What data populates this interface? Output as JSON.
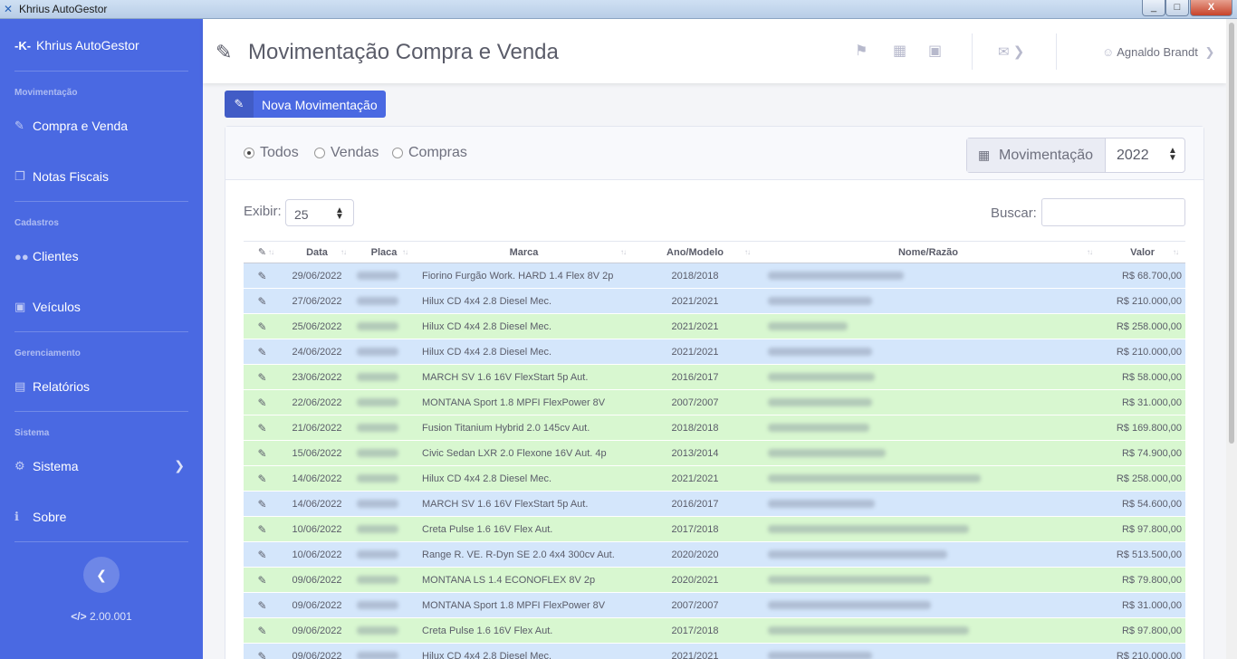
{
  "window": {
    "title": "Khrius AutoGestor",
    "min": "_",
    "max": "□",
    "close": "X"
  },
  "sidebar": {
    "brand": "Khrius AutoGestor",
    "logo": "-K-",
    "sections": [
      {
        "heading": "Movimentação",
        "items": [
          {
            "label": "Compra e Venda",
            "icon": "hand-money-icon"
          },
          {
            "label": "Notas Fiscais",
            "icon": "copy-icon"
          }
        ]
      },
      {
        "heading": "Cadastros",
        "items": [
          {
            "label": "Clientes",
            "icon": "users-icon"
          },
          {
            "label": "Veículos",
            "icon": "car-icon"
          }
        ]
      },
      {
        "heading": "Gerenciamento",
        "items": [
          {
            "label": "Relatórios",
            "icon": "file-icon"
          }
        ]
      },
      {
        "heading": "Sistema",
        "items": [
          {
            "label": "Sistema",
            "icon": "gear-icon"
          },
          {
            "label": "Sobre",
            "icon": "info-icon"
          }
        ]
      }
    ],
    "version": "2.00.001"
  },
  "header": {
    "title": "Movimentação Compra e Venda",
    "user": "Agnaldo Brandt"
  },
  "toolbar": {
    "new_button": "Nova Movimentação"
  },
  "filters": {
    "options": [
      "Todos",
      "Vendas",
      "Compras"
    ],
    "selected": "Todos",
    "movimentacao_label": "Movimentação",
    "year": "2022"
  },
  "table_controls": {
    "exibir_label": "Exibir:",
    "exibir_value": "25",
    "buscar_label": "Buscar:",
    "buscar_value": ""
  },
  "table": {
    "columns": [
      "Data",
      "Placa",
      "Marca",
      "Ano/Modelo",
      "Nome/Razão",
      "Valor"
    ],
    "rows": [
      {
        "tipo": "venda",
        "data": "29/06/2022",
        "marca": "Fiorino Furgão Work. HARD 1.4 Flex 8V 2p",
        "ano": "2018/2018",
        "valor": "R$ 68.700,00"
      },
      {
        "tipo": "venda",
        "data": "27/06/2022",
        "marca": "Hilux CD 4x4 2.8 Diesel Mec.",
        "ano": "2021/2021",
        "valor": "R$ 210.000,00"
      },
      {
        "tipo": "compra",
        "data": "25/06/2022",
        "marca": "Hilux CD 4x4 2.8 Diesel Mec.",
        "ano": "2021/2021",
        "valor": "R$ 258.000,00"
      },
      {
        "tipo": "venda",
        "data": "24/06/2022",
        "marca": "Hilux CD 4x4 2.8 Diesel Mec.",
        "ano": "2021/2021",
        "valor": "R$ 210.000,00"
      },
      {
        "tipo": "compra",
        "data": "23/06/2022",
        "marca": "MARCH SV 1.6 16V FlexStart 5p Aut.",
        "ano": "2016/2017",
        "valor": "R$ 58.000,00"
      },
      {
        "tipo": "compra",
        "data": "22/06/2022",
        "marca": "MONTANA Sport 1.8 MPFI FlexPower 8V",
        "ano": "2007/2007",
        "valor": "R$ 31.000,00"
      },
      {
        "tipo": "compra",
        "data": "21/06/2022",
        "marca": "Fusion Titanium Hybrid 2.0 145cv Aut.",
        "ano": "2018/2018",
        "valor": "R$ 169.800,00"
      },
      {
        "tipo": "compra",
        "data": "15/06/2022",
        "marca": "Civic Sedan LXR 2.0 Flexone 16V Aut. 4p",
        "ano": "2013/2014",
        "valor": "R$ 74.900,00"
      },
      {
        "tipo": "compra",
        "data": "14/06/2022",
        "marca": "Hilux CD 4x4 2.8 Diesel Mec.",
        "ano": "2021/2021",
        "valor": "R$ 258.000,00"
      },
      {
        "tipo": "venda",
        "data": "14/06/2022",
        "marca": "MARCH SV 1.6 16V FlexStart 5p Aut.",
        "ano": "2016/2017",
        "valor": "R$ 54.600,00"
      },
      {
        "tipo": "compra",
        "data": "10/06/2022",
        "marca": "Creta Pulse 1.6 16V Flex Aut.",
        "ano": "2017/2018",
        "valor": "R$ 97.800,00"
      },
      {
        "tipo": "venda",
        "data": "10/06/2022",
        "marca": "Range R. VE. R-Dyn SE 2.0 4x4 300cv Aut.",
        "ano": "2020/2020",
        "valor": "R$ 513.500,00"
      },
      {
        "tipo": "compra",
        "data": "09/06/2022",
        "marca": "MONTANA LS 1.4 ECONOFLEX 8V 2p",
        "ano": "2020/2021",
        "valor": "R$ 79.800,00"
      },
      {
        "tipo": "venda",
        "data": "09/06/2022",
        "marca": "MONTANA Sport 1.8 MPFI FlexPower 8V",
        "ano": "2007/2007",
        "valor": "R$ 31.000,00"
      },
      {
        "tipo": "compra",
        "data": "09/06/2022",
        "marca": "Creta Pulse 1.6 16V Flex Aut.",
        "ano": "2017/2018",
        "valor": "R$ 97.800,00"
      },
      {
        "tipo": "venda",
        "data": "09/06/2022",
        "marca": "Hilux CD 4x4 2.8 Diesel Mec.",
        "ano": "2021/2021",
        "valor": "R$ 210.000,00"
      }
    ]
  },
  "colors": {
    "sidebar": "#4a69e2",
    "venda_row": "#d4e6fb",
    "compra_row": "#d8f7d0",
    "accent": "#4a69e2"
  }
}
